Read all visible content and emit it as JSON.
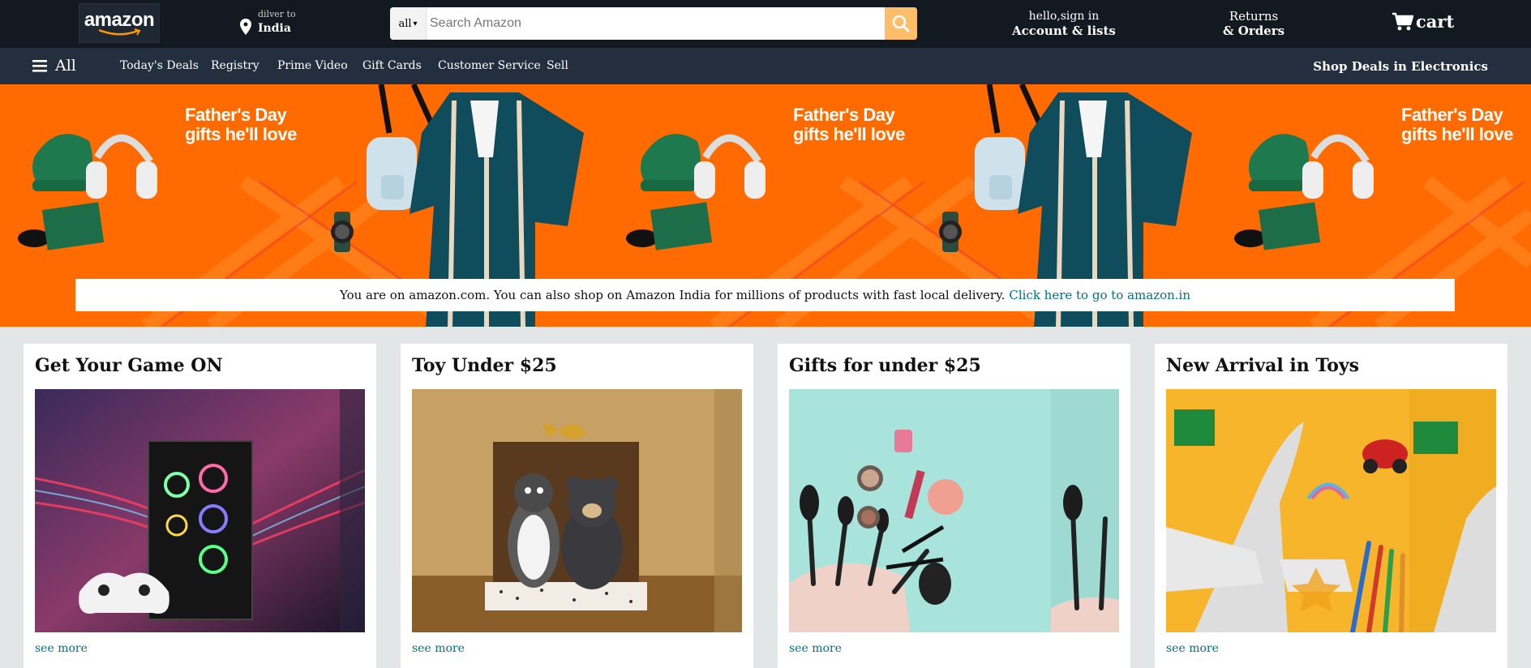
{
  "header": {
    "logo_text": "amazon",
    "deliver_small": "dilver to",
    "deliver_location": "India",
    "search": {
      "category": "all",
      "placeholder": "Search Amazon"
    },
    "account_line1": "hello,sign in",
    "account_line2": "Account & lists",
    "returns_line1": "Returns",
    "returns_line2": "& Orders",
    "cart_label": "cart"
  },
  "subnav": {
    "all_label": "All",
    "items": [
      "Today's Deals",
      "Registry",
      "Prime Video",
      "Gift Cards",
      "Customer Service",
      "Sell"
    ],
    "right_link": "Shop Deals in Electronics"
  },
  "hero": {
    "headline_line1": "Father's Day",
    "headline_line2": "gifts he'll love",
    "notice_text": "You are on amazon.com. You can also shop on Amazon India for millions of products with fast local delivery.",
    "notice_link": "Click here to go to amazon.in"
  },
  "cards": [
    {
      "title": "Get Your Game ON",
      "link": "see more"
    },
    {
      "title": "Toy Under $25",
      "link": "see more"
    },
    {
      "title": "Gifts for under $25",
      "link": "see more"
    },
    {
      "title": "New Arrival in Toys",
      "link": "see more"
    }
  ],
  "colors": {
    "nav_dark": "#131921",
    "subnav": "#232f3e",
    "search_button": "#febd69",
    "hero_orange": "#ff6b00",
    "link": "#007185"
  }
}
